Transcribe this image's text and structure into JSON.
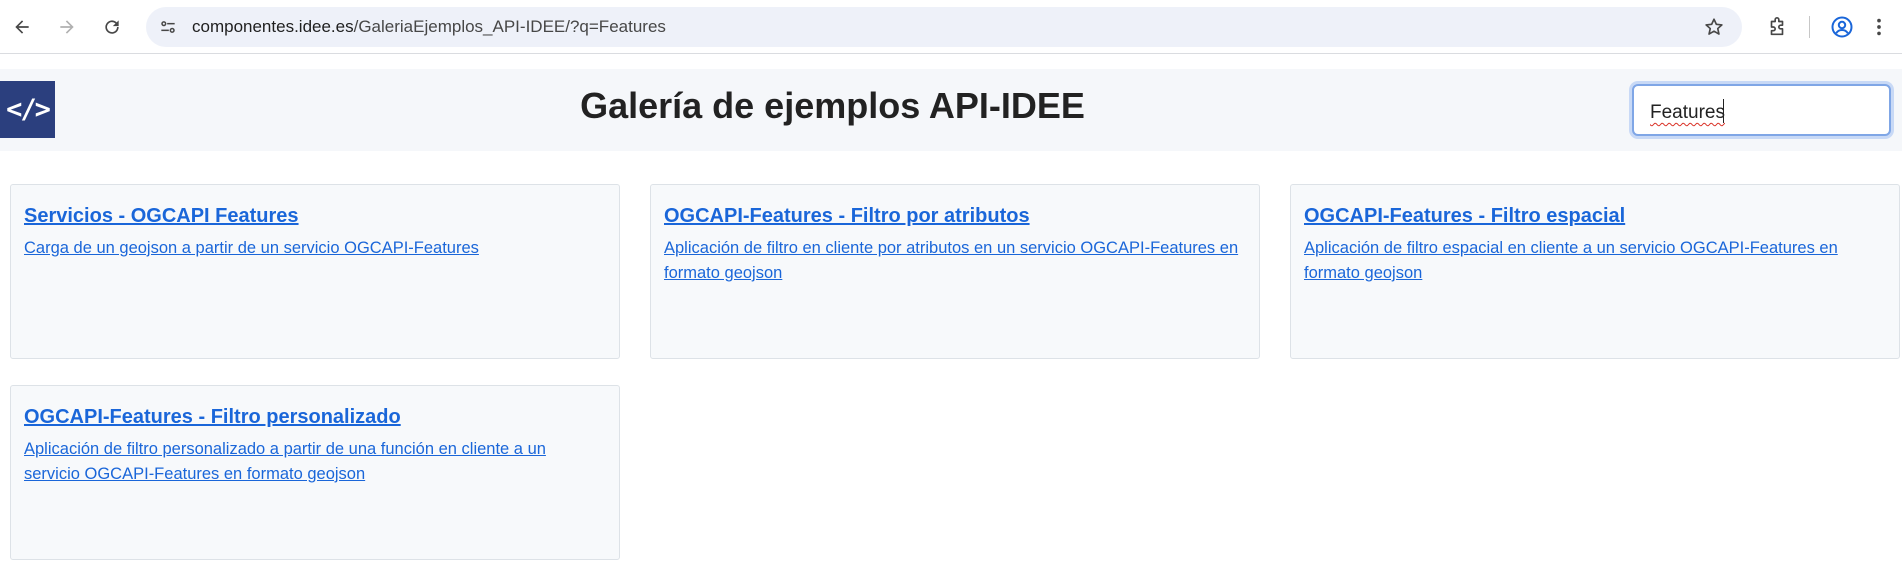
{
  "browser": {
    "url_host": "componentes.idee.es",
    "url_path": "/GaleriaEjemplos_API-IDEE/?q=Features"
  },
  "header": {
    "logo_text": "</>",
    "title": "Galería de ejemplos API-IDEE",
    "search_value": "Features"
  },
  "cards": [
    {
      "title": "Servicios - OGCAPI Features",
      "description": "Carga de un geojson a partir de un servicio OGCAPI-Features"
    },
    {
      "title": "OGCAPI-Features - Filtro por atributos",
      "description": "Aplicación de filtro en cliente por atributos en un servicio OGCAPI-Features en formato geojson"
    },
    {
      "title": "OGCAPI-Features - Filtro espacial",
      "description": "Aplicación de filtro espacial en cliente a un servicio OGCAPI-Features en formato geojson"
    },
    {
      "title": "OGCAPI-Features - Filtro personalizado",
      "description": "Aplicación de filtro personalizado a partir de una función en cliente a un servicio OGCAPI-Features en formato geojson"
    }
  ],
  "colors": {
    "link": "#1a66d9",
    "logo_bg": "#2b3f7e",
    "header_bg": "#f5f7fa",
    "card_bg": "#f7f9fb"
  }
}
